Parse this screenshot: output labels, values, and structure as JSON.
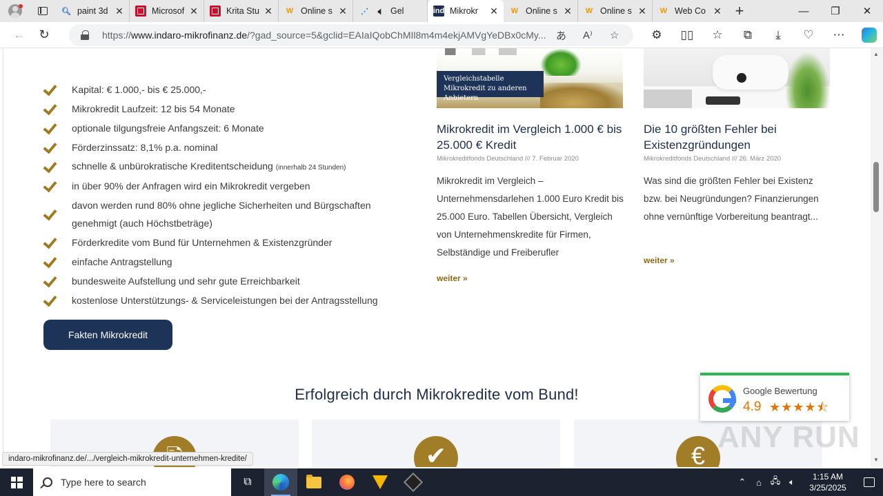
{
  "browser": {
    "tabs": [
      {
        "title": "paint 3d",
        "icon": "search-icon",
        "active": false
      },
      {
        "title": "Microsof",
        "icon": "krita-icon",
        "active": false
      },
      {
        "title": "Krita Stu",
        "icon": "krita-icon",
        "active": false
      },
      {
        "title": "Online s",
        "icon": "w-icon",
        "active": false
      },
      {
        "title": "Gel",
        "icon": "speaker-icon",
        "active": false
      },
      {
        "title": "Mikrokr",
        "icon": "indaro-icon",
        "active": true
      },
      {
        "title": "Online s",
        "icon": "w-icon",
        "active": false
      },
      {
        "title": "Online s",
        "icon": "w-icon",
        "active": false
      },
      {
        "title": "Web Co",
        "icon": "w-icon",
        "active": false
      }
    ],
    "address": {
      "prefix": "https://",
      "domain": "www.indaro-mikrofinanz.de",
      "rest": "/?gad_source=5&gclid=EAIaIQobChMIl8m4m4ekjAMVgYeDBx0cMy..."
    }
  },
  "page": {
    "checklist": [
      {
        "text": "Kapital: € 1.000,- bis € 25.000,-",
        "note": ""
      },
      {
        "text": "Mikrokredit Laufzeit: 12 bis 54 Monate",
        "note": ""
      },
      {
        "text": "optionale tilgungsfreie Anfangszeit: 6 Monate",
        "note": ""
      },
      {
        "text": "Förderzinssatz: 8,1% p.a. nominal",
        "note": ""
      },
      {
        "text": "schnelle & unbürokratische Kreditentscheidung",
        "note": "(innerhalb 24 Stunden)"
      },
      {
        "text": "in über 90% der Anfragen wird ein Mikrokredit vergeben",
        "note": ""
      },
      {
        "text": "davon werden rund 80% ohne jegliche Sicherheiten und Bürgschaften genehmigt (auch Höchstbeträge)",
        "note": ""
      },
      {
        "text": "Förderkredite vom Bund für Unternehmen & Existenzgründer",
        "note": ""
      },
      {
        "text": "einfache Antragstellung",
        "note": ""
      },
      {
        "text": "bundesweite Aufstellung und sehr gute Erreichbarkeit",
        "note": ""
      },
      {
        "text": "kostenlose Unterstützungs- & Serviceleistungen bei der Antragsstellung",
        "note": ""
      }
    ],
    "cta_label": "Fakten Mikrokredit",
    "posts": [
      {
        "image_caption": "Vergleichstabelle Mikrokredit zu anderen Anbietern",
        "title": "Mikrokredit im Vergleich 1.000 € bis 25.000 € Kredit",
        "meta": "Mikrokreditfonds Deutschland /// 7. Februar 2020",
        "excerpt": "Mikrokredit im Vergleich – Unternehmensdarlehen 1.000 Euro Kredit bis 25.000 Euro. Tabellen Übersicht, Vergleich von Unternehmenskredite für Firmen, Selbständige und Freiberufler",
        "more": "weiter »"
      },
      {
        "image_caption": "",
        "title": "Die 10 größten Fehler bei Existenzgründungen",
        "meta": "Mikrokreditfonds Deutschland /// 26. März 2020",
        "excerpt": "Was sind die größten Fehler bei Existenz bzw. bei Neugründungen? Finanzierungen ohne vernünftige Vorbereitung beantragt...",
        "more": "weiter »"
      }
    ],
    "section_title": "Erfolgreich durch Mikrokredite vom Bund!",
    "feature_icons": [
      "document-icon",
      "check-icon",
      "euro-icon"
    ],
    "google": {
      "label": "Google Bewertung",
      "rating": "4.9",
      "rating_value": 4.5,
      "stars": "★★★★⯪"
    },
    "watermark": "ANY RUN",
    "status_url": "indaro-mikrofinanz.de/.../vergleich-mikrokredit-unternehmen-kredite/"
  },
  "taskbar": {
    "search_placeholder": "Type here to search",
    "time": "1:15 AM",
    "date": "3/25/2025"
  },
  "colors": {
    "accent_gold": "#a07d26",
    "navy": "#1d3358",
    "google_green": "#2fb457"
  }
}
